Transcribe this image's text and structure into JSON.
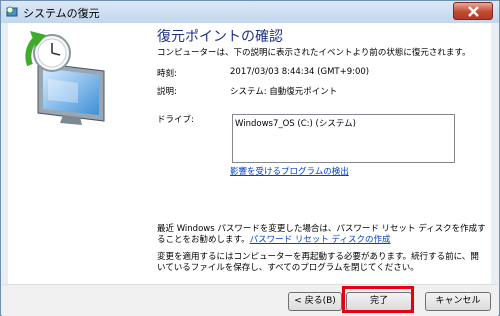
{
  "window": {
    "title": "システムの復元"
  },
  "page": {
    "heading": "復元ポイントの確認",
    "intro": "コンピューターは、下の説明に表示されたイベントより前の状態に復元されます。",
    "time_label": "時刻:",
    "time_value": "2017/03/03 8:44:34 (GMT+9:00)",
    "desc_label": "説明:",
    "desc_value": "システム: 自動復元ポイント",
    "drive_label": "ドライブ:",
    "drives": [
      "Windows7_OS (C:) (システム)"
    ],
    "affected_link": "影響を受けるプログラムの検出",
    "password_note": "最近 Windows パスワードを変更した場合は、パスワード リセット ディスクを作成することをお勧めします。",
    "password_link": "パスワード リセット ディスクの作成",
    "restart_note": "変更を適用するにはコンピューターを再起動する必要があります。続行する前に、開いているファイルを保存し、すべてのプログラムを閉じてください。"
  },
  "buttons": {
    "back": "< 戻る(B)",
    "finish": "完了",
    "cancel": "キャンセル"
  },
  "colors": {
    "heading": "#1e3287",
    "link": "#0044cc",
    "highlight": "#e60012"
  }
}
